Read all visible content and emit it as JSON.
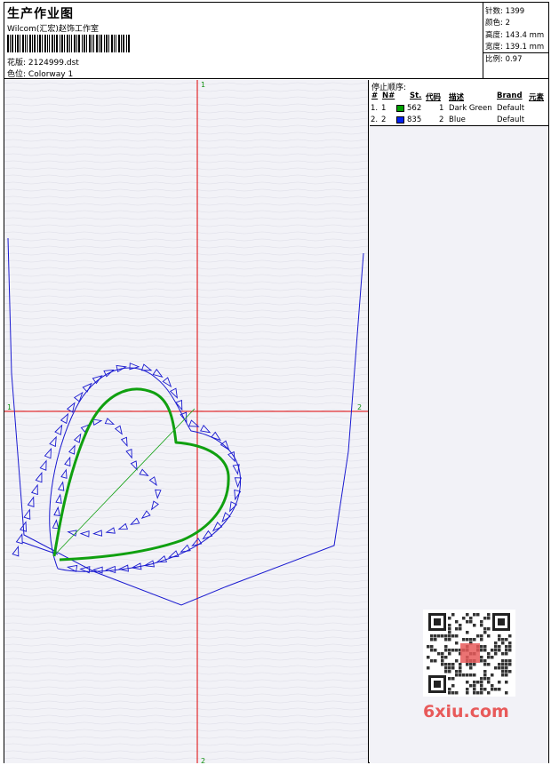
{
  "header": {
    "title": "生产作业图",
    "studio": "Wilcom(汇宏)赵饰工作室",
    "design_label": "花版:",
    "design_value": "2124999.dst",
    "colorway_label": "色位:",
    "colorway_value": "Colorway 1"
  },
  "stats": {
    "stitches": "针数: 1399",
    "colors": "颜色: 2",
    "height": "高度: 143.4 mm",
    "width": "宽度: 139.1 mm",
    "scale": "比例: 0.97"
  },
  "stop_sequence": {
    "title": "停止顺序:",
    "headers": {
      "hash": "#",
      "no": "N#",
      "st": "St.",
      "code": "代码",
      "desc": "描述",
      "brand": "Brand",
      "elem": "元素"
    },
    "rows": [
      {
        "idx": "1.",
        "n": "1",
        "st": "562",
        "code": "1",
        "desc": "Dark Green",
        "brand": "Default",
        "color": "#00a000"
      },
      {
        "idx": "2.",
        "n": "2",
        "st": "835",
        "code": "2",
        "desc": "Blue",
        "brand": "Default",
        "color": "#0020f0"
      }
    ]
  },
  "axis_markers": {
    "top": "1",
    "bottom": "2",
    "left": "1",
    "right": "2"
  },
  "colors": {
    "cross": "#e00000",
    "green_stitch": "#10a010",
    "blue_stitch": "#1a1ad0",
    "watermark": "#e85a5a"
  },
  "watermark": {
    "site": "6xiu.com"
  }
}
